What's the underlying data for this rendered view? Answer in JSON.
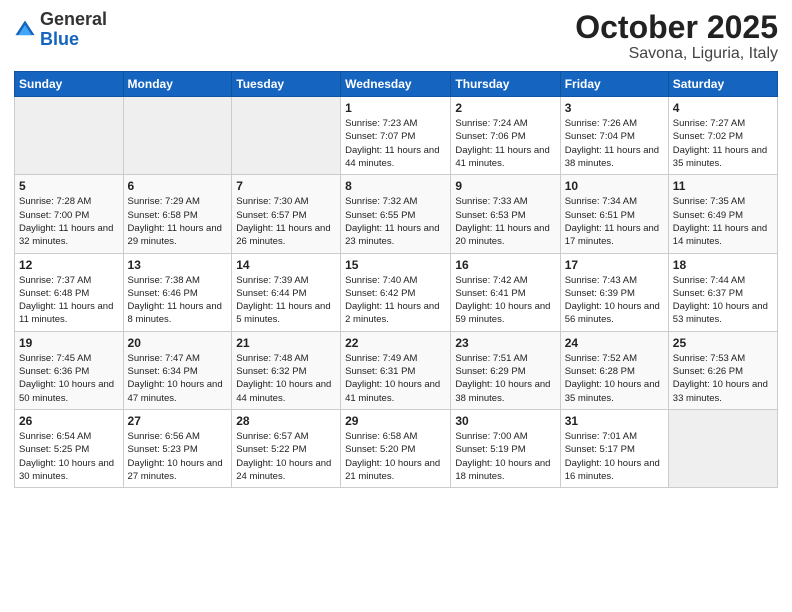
{
  "logo": {
    "general": "General",
    "blue": "Blue"
  },
  "title": "October 2025",
  "subtitle": "Savona, Liguria, Italy",
  "days_of_week": [
    "Sunday",
    "Monday",
    "Tuesday",
    "Wednesday",
    "Thursday",
    "Friday",
    "Saturday"
  ],
  "weeks": [
    [
      {
        "day": "",
        "info": ""
      },
      {
        "day": "",
        "info": ""
      },
      {
        "day": "",
        "info": ""
      },
      {
        "day": "1",
        "info": "Sunrise: 7:23 AM\nSunset: 7:07 PM\nDaylight: 11 hours and 44 minutes."
      },
      {
        "day": "2",
        "info": "Sunrise: 7:24 AM\nSunset: 7:06 PM\nDaylight: 11 hours and 41 minutes."
      },
      {
        "day": "3",
        "info": "Sunrise: 7:26 AM\nSunset: 7:04 PM\nDaylight: 11 hours and 38 minutes."
      },
      {
        "day": "4",
        "info": "Sunrise: 7:27 AM\nSunset: 7:02 PM\nDaylight: 11 hours and 35 minutes."
      }
    ],
    [
      {
        "day": "5",
        "info": "Sunrise: 7:28 AM\nSunset: 7:00 PM\nDaylight: 11 hours and 32 minutes."
      },
      {
        "day": "6",
        "info": "Sunrise: 7:29 AM\nSunset: 6:58 PM\nDaylight: 11 hours and 29 minutes."
      },
      {
        "day": "7",
        "info": "Sunrise: 7:30 AM\nSunset: 6:57 PM\nDaylight: 11 hours and 26 minutes."
      },
      {
        "day": "8",
        "info": "Sunrise: 7:32 AM\nSunset: 6:55 PM\nDaylight: 11 hours and 23 minutes."
      },
      {
        "day": "9",
        "info": "Sunrise: 7:33 AM\nSunset: 6:53 PM\nDaylight: 11 hours and 20 minutes."
      },
      {
        "day": "10",
        "info": "Sunrise: 7:34 AM\nSunset: 6:51 PM\nDaylight: 11 hours and 17 minutes."
      },
      {
        "day": "11",
        "info": "Sunrise: 7:35 AM\nSunset: 6:49 PM\nDaylight: 11 hours and 14 minutes."
      }
    ],
    [
      {
        "day": "12",
        "info": "Sunrise: 7:37 AM\nSunset: 6:48 PM\nDaylight: 11 hours and 11 minutes."
      },
      {
        "day": "13",
        "info": "Sunrise: 7:38 AM\nSunset: 6:46 PM\nDaylight: 11 hours and 8 minutes."
      },
      {
        "day": "14",
        "info": "Sunrise: 7:39 AM\nSunset: 6:44 PM\nDaylight: 11 hours and 5 minutes."
      },
      {
        "day": "15",
        "info": "Sunrise: 7:40 AM\nSunset: 6:42 PM\nDaylight: 11 hours and 2 minutes."
      },
      {
        "day": "16",
        "info": "Sunrise: 7:42 AM\nSunset: 6:41 PM\nDaylight: 10 hours and 59 minutes."
      },
      {
        "day": "17",
        "info": "Sunrise: 7:43 AM\nSunset: 6:39 PM\nDaylight: 10 hours and 56 minutes."
      },
      {
        "day": "18",
        "info": "Sunrise: 7:44 AM\nSunset: 6:37 PM\nDaylight: 10 hours and 53 minutes."
      }
    ],
    [
      {
        "day": "19",
        "info": "Sunrise: 7:45 AM\nSunset: 6:36 PM\nDaylight: 10 hours and 50 minutes."
      },
      {
        "day": "20",
        "info": "Sunrise: 7:47 AM\nSunset: 6:34 PM\nDaylight: 10 hours and 47 minutes."
      },
      {
        "day": "21",
        "info": "Sunrise: 7:48 AM\nSunset: 6:32 PM\nDaylight: 10 hours and 44 minutes."
      },
      {
        "day": "22",
        "info": "Sunrise: 7:49 AM\nSunset: 6:31 PM\nDaylight: 10 hours and 41 minutes."
      },
      {
        "day": "23",
        "info": "Sunrise: 7:51 AM\nSunset: 6:29 PM\nDaylight: 10 hours and 38 minutes."
      },
      {
        "day": "24",
        "info": "Sunrise: 7:52 AM\nSunset: 6:28 PM\nDaylight: 10 hours and 35 minutes."
      },
      {
        "day": "25",
        "info": "Sunrise: 7:53 AM\nSunset: 6:26 PM\nDaylight: 10 hours and 33 minutes."
      }
    ],
    [
      {
        "day": "26",
        "info": "Sunrise: 6:54 AM\nSunset: 5:25 PM\nDaylight: 10 hours and 30 minutes."
      },
      {
        "day": "27",
        "info": "Sunrise: 6:56 AM\nSunset: 5:23 PM\nDaylight: 10 hours and 27 minutes."
      },
      {
        "day": "28",
        "info": "Sunrise: 6:57 AM\nSunset: 5:22 PM\nDaylight: 10 hours and 24 minutes."
      },
      {
        "day": "29",
        "info": "Sunrise: 6:58 AM\nSunset: 5:20 PM\nDaylight: 10 hours and 21 minutes."
      },
      {
        "day": "30",
        "info": "Sunrise: 7:00 AM\nSunset: 5:19 PM\nDaylight: 10 hours and 18 minutes."
      },
      {
        "day": "31",
        "info": "Sunrise: 7:01 AM\nSunset: 5:17 PM\nDaylight: 10 hours and 16 minutes."
      },
      {
        "day": "",
        "info": ""
      }
    ]
  ]
}
